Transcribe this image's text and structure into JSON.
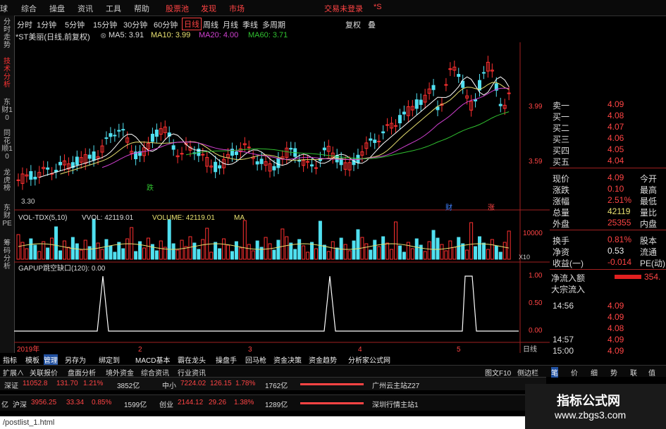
{
  "menu": {
    "items": [
      "球",
      "综合",
      "操盘",
      "资讯",
      "工具",
      "帮助",
      "股票池",
      "发现",
      "市场"
    ],
    "login": "交易未登录",
    "login_suffix": "*S"
  },
  "left_tabs": [
    "分时走势",
    "技术分析",
    "东财10",
    "同花顺10",
    "龙虎榜",
    "东财PE",
    "筹码分析"
  ],
  "periods": [
    "分时",
    "1分钟",
    "5分钟",
    "15分钟",
    "30分钟",
    "60分钟",
    "日线",
    "周线",
    "月线",
    "季线",
    "多周期"
  ],
  "period_right": [
    "复权",
    "叠"
  ],
  "header": {
    "stock": "*ST美丽(日线,前复权)",
    "ma5": "MA5: 3.91",
    "ma10": "MA10: 3.99",
    "ma20": "MA20: 4.00",
    "ma60": "MA60: 3.71"
  },
  "price_axis": [
    "3.99",
    "3.59"
  ],
  "price_low": "3.30",
  "markers": [
    "跌",
    "财",
    "涨"
  ],
  "vol_header": {
    "name": "VOL-TDX(5,10)",
    "vvol": "VVOL: 42119.01",
    "volume": "VOLUME: 42119.01",
    "ma": "MA"
  },
  "vol_axis": [
    "10000",
    "X10"
  ],
  "gap_header": "GAPUP跳空缺口(120): 0.00",
  "gap_axis": [
    "1.00",
    "0.50",
    "0.00"
  ],
  "time_axis": [
    "2019年",
    "2",
    "3",
    "4",
    "5"
  ],
  "timeframe_label": "日线",
  "quotes": [
    {
      "label": "卖一",
      "value": "4.09",
      "extra": ""
    },
    {
      "label": "买一",
      "value": "4.08",
      "extra": ""
    },
    {
      "label": "买二",
      "value": "4.07",
      "extra": ""
    },
    {
      "label": "买三",
      "value": "4.06",
      "extra": ""
    },
    {
      "label": "买四",
      "value": "4.05",
      "extra": ""
    },
    {
      "label": "买五",
      "value": "4.04",
      "extra": ""
    },
    {
      "label": "现价",
      "value": "4.09",
      "extra": "今开"
    },
    {
      "label": "涨跌",
      "value": "0.10",
      "extra": "最高"
    },
    {
      "label": "涨幅",
      "value": "2.51%",
      "extra": "最低"
    },
    {
      "label": "总量",
      "value": "42119",
      "extra": "量比"
    },
    {
      "label": "外盘",
      "value": "25355",
      "extra": "内盘"
    },
    {
      "label": "换手",
      "value": "0.81%",
      "extra": "股本"
    },
    {
      "label": "净资",
      "value": "0.53",
      "extra": "流通"
    },
    {
      "label": "收益(一)",
      "value": "-0.014",
      "extra": "PE(动)"
    }
  ],
  "netflow": {
    "label": "净流入额",
    "value": "354.",
    "label2": "大宗流入"
  },
  "ticks": [
    {
      "time": "14:56",
      "price": "4.09"
    },
    {
      "time": "",
      "price": "4.09"
    },
    {
      "time": "",
      "price": "4.08"
    },
    {
      "time": "14:57",
      "price": "4.09"
    },
    {
      "time": "15:00",
      "price": "4.09"
    }
  ],
  "tabs": [
    "指标",
    "模板",
    "管理",
    "另存为",
    "绑定到",
    "MACD基本",
    "霸在龙头",
    "操盘手",
    "回马枪",
    "资金决策",
    "资金趋势",
    "分析家公式网"
  ],
  "bottom_tabs": [
    "扩展∧",
    "关联报价",
    "盘面分析",
    "境外资金",
    "综合资讯",
    "行业资讯"
  ],
  "bottom_right": [
    "图文F10",
    "侧边栏",
    "笔",
    "价",
    "细",
    "势",
    "联",
    "值"
  ],
  "status1": {
    "index1": "深证",
    "v1": "11052.8",
    "c1": "131.70",
    "p1": "1.21%",
    "amt1": "3852亿",
    "index2": "中小",
    "v2": "7224.02",
    "c2": "126.15",
    "p2": "1.78%",
    "amt2": "1762亿",
    "server": "广州云主站Z27"
  },
  "status2": {
    "pre": "亿",
    "index1": "沪深",
    "v1": "3956.25",
    "c1": "33.34",
    "p1": "0.85%",
    "amt1": "1599亿",
    "index2": "创业",
    "v2": "2144.12",
    "c2": "29.26",
    "p2": "1.38%",
    "amt2": "1289亿",
    "server": "深圳行情主站1"
  },
  "watermark": {
    "title": "指标公式网",
    "url": "www.zbgs3.com"
  },
  "url_strip": "/postlist_1.html"
}
